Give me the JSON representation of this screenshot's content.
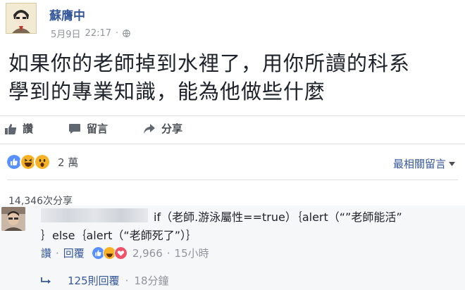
{
  "post": {
    "author": "蘇膺中",
    "date": "5月9日",
    "time": "22:17",
    "separator": "·",
    "text_line1": "如果你的老師掉到水裡了，用你所讀的科系",
    "text_line2": "學到的專業知識，能為他做些什麼"
  },
  "actions": {
    "like": "讚",
    "comment": "留言",
    "share": "分享"
  },
  "reactions": {
    "count": "2 萬",
    "sort_label": "最相關留言",
    "icons": [
      "like-reaction-icon",
      "haha-reaction-icon",
      "wow-reaction-icon"
    ]
  },
  "share_count": "14,346次分享",
  "comment": {
    "line1": "if（老師.游泳屬性==true）｛alert（“”老師能活”",
    "line2": "｝else｛alert（“老師死了”）｝",
    "like": "讚",
    "dot": "·",
    "reply": "回覆",
    "reaction_count": "2,966",
    "time": "15小時"
  },
  "replies": {
    "label": "125則回覆",
    "dot": "·",
    "time": "18分鐘"
  },
  "colors": {
    "link": "#365899",
    "text": "#1d2129",
    "muted": "#90949c",
    "like_blue": "#5890ff",
    "haha_yellow": "#f7b125"
  }
}
